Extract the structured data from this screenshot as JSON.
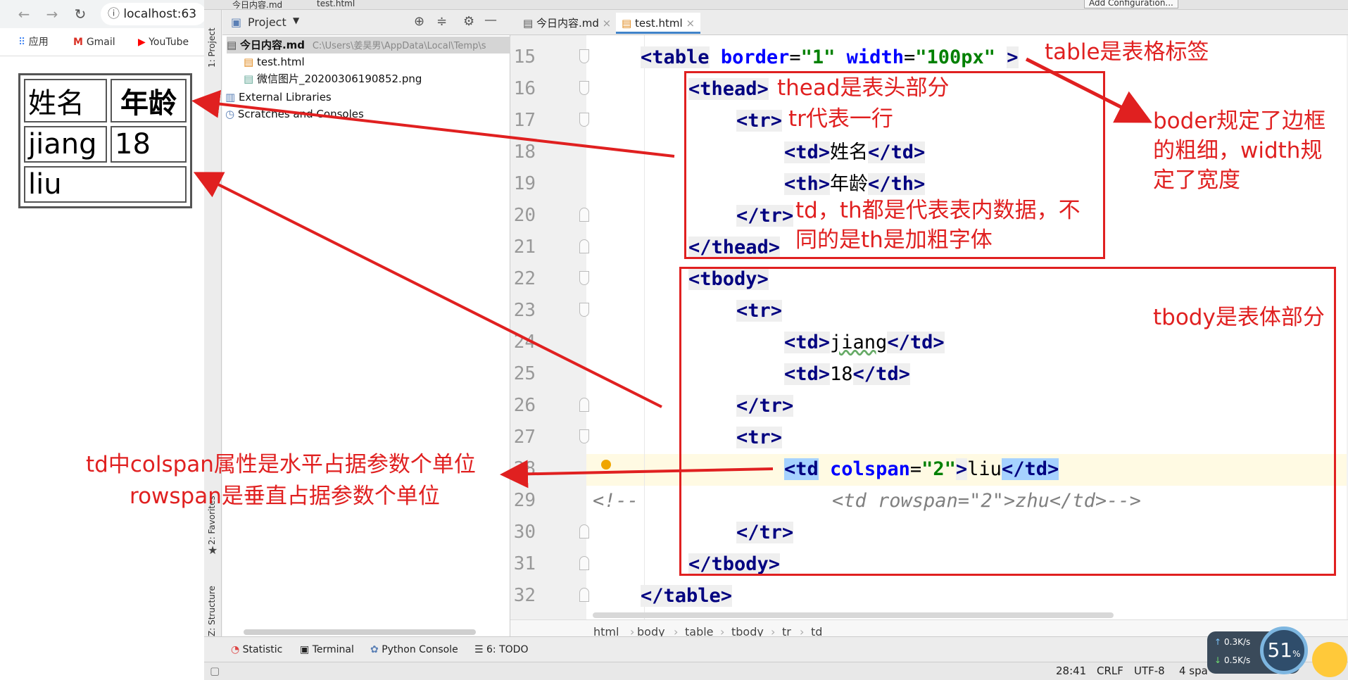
{
  "browser": {
    "url": "localhost:63",
    "bookmarks": [
      "应用",
      "Gmail",
      "YouTube"
    ],
    "table": {
      "row1": [
        "姓名",
        "年龄"
      ],
      "row2": [
        "jiang",
        "18"
      ],
      "row3": [
        "liu"
      ]
    }
  },
  "ide": {
    "top_breadcrumb": [
      "今日内容.md",
      "test.html"
    ],
    "add_config": "Add Configuration...",
    "vertical_tabs": [
      "1: Project",
      "2: Favorites",
      "Z: Structure"
    ],
    "project_header": "Project",
    "tree": [
      {
        "label": "今日内容.md",
        "path": "C:\\Users\\姜昊男\\AppData\\Local\\Temp\\s"
      },
      {
        "label": "test.html"
      },
      {
        "label": "微信图片_20200306190852.png"
      },
      {
        "label": "External Libraries"
      },
      {
        "label": "Scratches and Consoles"
      }
    ],
    "tabs": [
      "今日内容.md",
      "test.html"
    ],
    "line_numbers": [
      "15",
      "16",
      "17",
      "18",
      "19",
      "20",
      "21",
      "22",
      "23",
      "24",
      "25",
      "26",
      "27",
      "28",
      "29",
      "30",
      "31",
      "32"
    ],
    "code": {
      "l15_open": "<table",
      "l15_a1": "border",
      "l15_v1": "\"1\"",
      "l15_a2": "width",
      "l15_v2": "\"100px\"",
      "l15_close": ">",
      "l16": "<thead>",
      "l17": "<tr>",
      "l18_o": "<td>",
      "l18_t": "姓名",
      "l18_c": "</td>",
      "l19_o": "<th>",
      "l19_t": "年龄",
      "l19_c": "</th>",
      "l20": "</tr>",
      "l21": "</thead>",
      "l22": "<tbody>",
      "l23": "<tr>",
      "l24_o": "<td>",
      "l24_t": "jiang",
      "l24_c": "</td>",
      "l25_o": "<td>",
      "l25_t": "18",
      "l25_c": "</td>",
      "l26": "</tr>",
      "l27": "<tr>",
      "l28_o": "<td",
      "l28_a": "colspan",
      "l28_v": "\"2\"",
      "l28_gt": ">",
      "l28_t": "liu",
      "l28_c": "</td>",
      "l29_a": "<!--",
      "l29_b": "<td rowspan=\"2\">zhu</td>-->",
      "l30": "</tr>",
      "l31": "</tbody>",
      "l32": "</table>"
    },
    "breadcrumb": [
      "html",
      "body",
      "table",
      "tbody",
      "tr",
      "td"
    ],
    "tool_windows": [
      "Statistic",
      "Terminal",
      "Python Console",
      "6: TODO"
    ],
    "status": {
      "position": "28:41",
      "line_sep": "CRLF",
      "encoding": "UTF-8",
      "indent": "4 spa"
    },
    "net": {
      "up": "0.3K/s",
      "down": "0.5K/s",
      "cpu": "51"
    }
  },
  "annotations": {
    "table_tag": "table是表格标签",
    "border_width": [
      "boder规定了边框",
      "的粗细，width规",
      "定了宽度"
    ],
    "thead": "thead是表头部分",
    "tr": "tr代表一行",
    "td_th": [
      "td，th都是代表表内数据，不",
      "同的是th是加粗字体"
    ],
    "tbody": "tbody是表体部分",
    "colspan": [
      "td中colspan属性是水平占据参数个单位",
      "rowspan是垂直占据参数个单位"
    ]
  },
  "colors": {
    "annotation": "#e02020",
    "tag": "#000080",
    "attr": "#0000ff",
    "value": "#008000"
  }
}
